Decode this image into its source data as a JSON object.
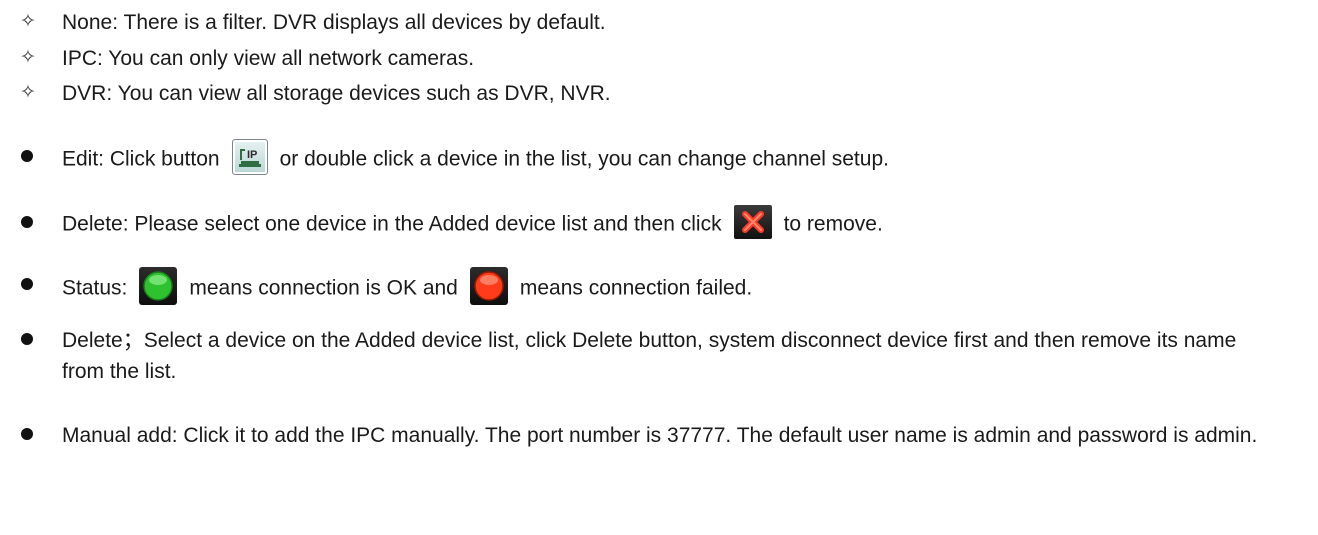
{
  "filter_items": [
    {
      "text": "None: There is a filter. DVR displays all devices by default.",
      "icon": "open-diamond"
    },
    {
      "text": "IPC: You can only view all network cameras.",
      "icon": "open-diamond"
    },
    {
      "text": "DVR: You can view all storage devices such as DVR, NVR.",
      "icon": "open-diamond"
    }
  ],
  "edit": {
    "before_icon": "Edit: Click button",
    "after_icon": "or double click a device in the list, you can change channel setup.",
    "icon": "ip-edit-icon"
  },
  "delete_icon_item": {
    "before_icon": "Delete: Please select one device in the Added device list and then click",
    "after_icon": "to remove.",
    "icon": "red-x-icon"
  },
  "status": {
    "label": "Status:",
    "ok_text": "means connection is OK and",
    "failed_text": "means connection failed.",
    "ok_color": "#33cc33",
    "failed_color": "#ff3b1a"
  },
  "delete_button_item": {
    "text": "Delete；Select a device on the Added device list, click Delete button, system disconnect device first and then remove its name from the list."
  },
  "manual_add": {
    "text": "Manual add: Click it to add the IPC manually. The port number is 37777. The default user name is admin and password is admin."
  }
}
